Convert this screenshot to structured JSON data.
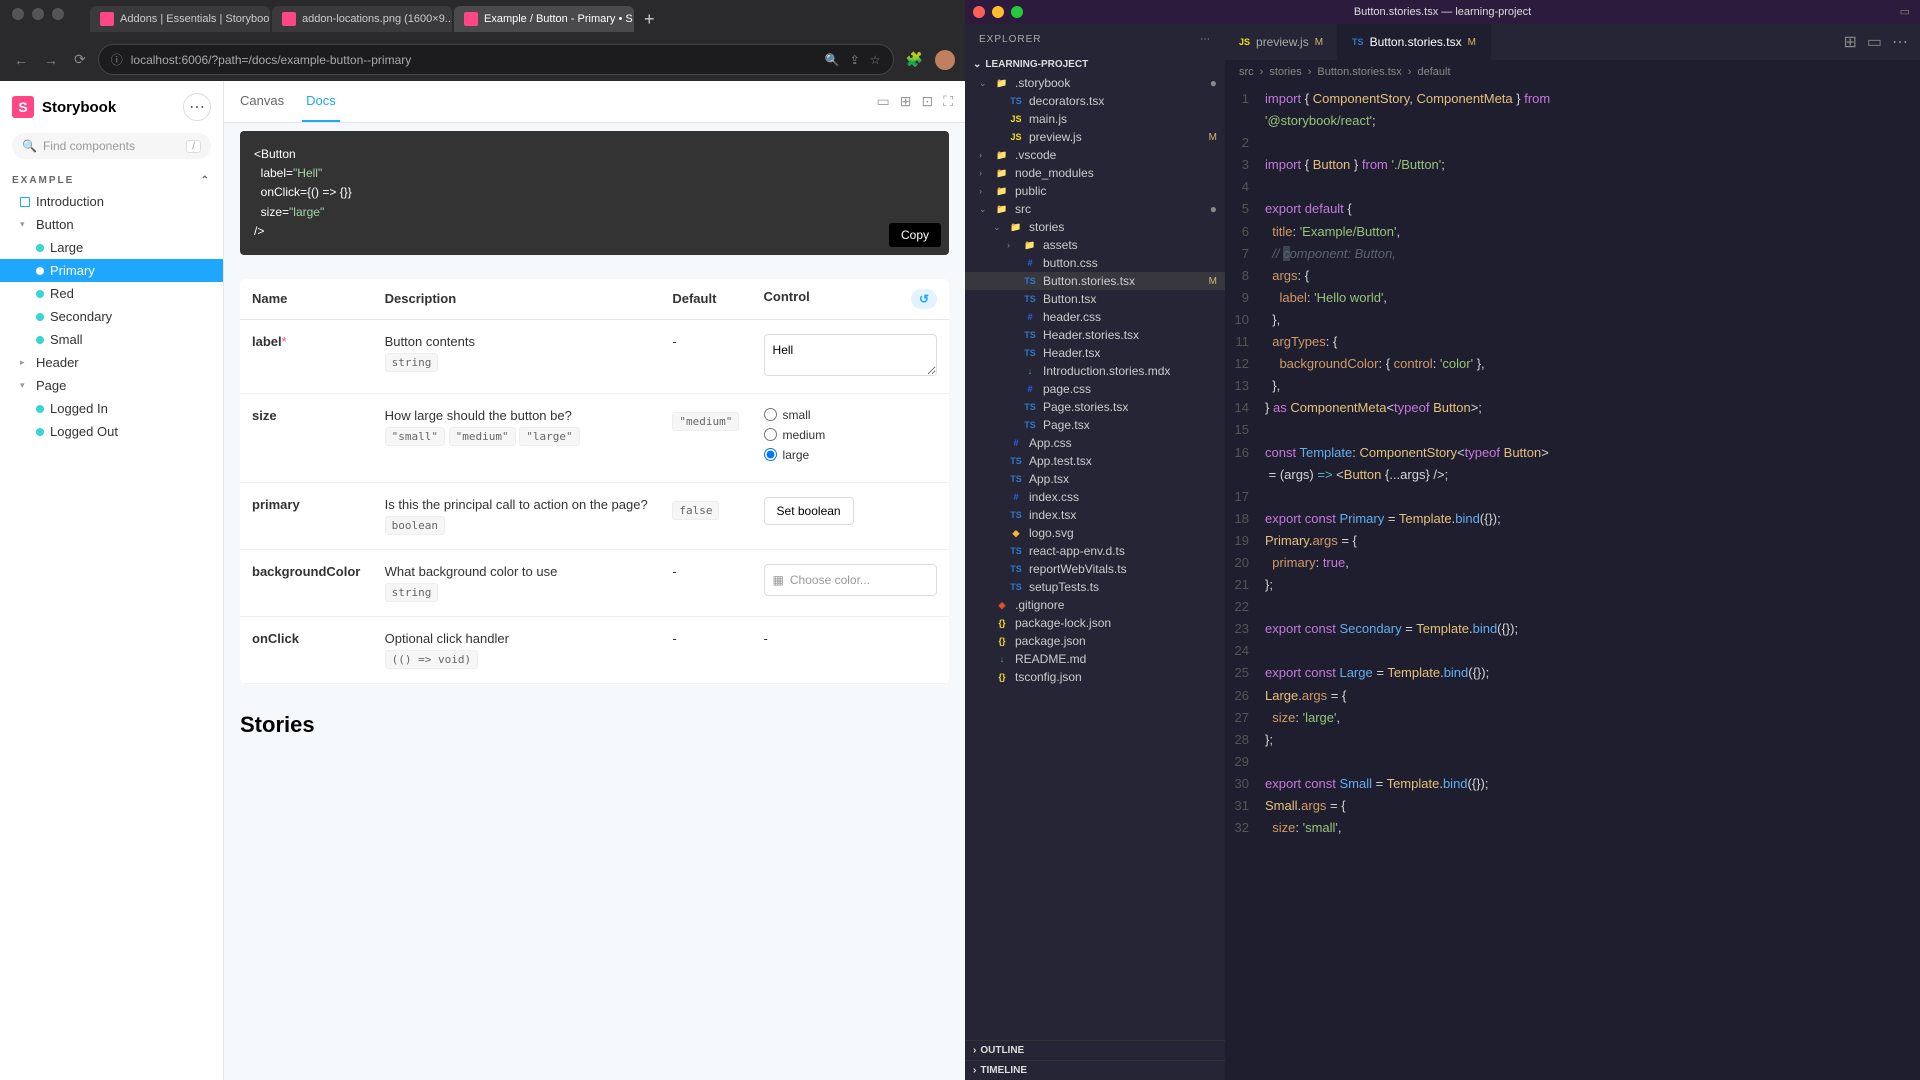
{
  "browser": {
    "tabs": [
      {
        "label": "Addons | Essentials | Storybook",
        "active": false
      },
      {
        "label": "addon-locations.png (1600×9...",
        "active": false
      },
      {
        "label": "Example / Button - Primary • S",
        "active": true
      }
    ],
    "url": "localhost:6006/?path=/docs/example-button--primary"
  },
  "storybook": {
    "brand": "Storybook",
    "search_placeholder": "Find components",
    "section": "EXAMPLE",
    "tree": {
      "intro": "Introduction",
      "button": "Button",
      "button_children": [
        "Large",
        "Primary",
        "Red",
        "Secondary",
        "Small"
      ],
      "active_child": "Primary",
      "header": "Header",
      "page": "Page",
      "page_children": [
        "Logged In",
        "Logged Out"
      ]
    },
    "tools": [
      "Canvas",
      "Docs"
    ],
    "active_tool": "Docs",
    "code_sample": "<Button\n  label=\"Hell\"\n  onClick={() => {}}\n  size=\"large\"\n/>",
    "copy": "Copy",
    "table_headers": [
      "Name",
      "Description",
      "Default",
      "Control"
    ],
    "args": [
      {
        "name": "label",
        "required": true,
        "desc": "Button contents",
        "type": "string",
        "default": "-",
        "control": "text",
        "value": "Hell"
      },
      {
        "name": "size",
        "required": false,
        "desc": "How large should the button be?",
        "types": [
          "\"small\"",
          "\"medium\"",
          "\"large\""
        ],
        "default": "\"medium\"",
        "control": "radio",
        "options": [
          "small",
          "medium",
          "large"
        ],
        "value": "large"
      },
      {
        "name": "primary",
        "required": false,
        "desc": "Is this the principal call to action on the page?",
        "type": "boolean",
        "default": "false",
        "control": "setbool",
        "btn": "Set boolean"
      },
      {
        "name": "backgroundColor",
        "required": false,
        "desc": "What background color to use",
        "type": "string",
        "default": "-",
        "control": "color",
        "placeholder": "Choose color..."
      },
      {
        "name": "onClick",
        "required": false,
        "desc": "Optional click handler",
        "type": "(() => void)",
        "default": "-",
        "control": "none",
        "value": "-"
      }
    ],
    "stories_heading": "Stories"
  },
  "vscode": {
    "title": "Button.stories.tsx — learning-project",
    "explorer_label": "EXPLORER",
    "project": "LEARNING-PROJECT",
    "outline": "OUTLINE",
    "timeline": "TIMELINE",
    "tree": [
      {
        "name": ".storybook",
        "type": "folder",
        "depth": 0,
        "open": true,
        "dot": true
      },
      {
        "name": "decorators.tsx",
        "type": "ts",
        "depth": 1
      },
      {
        "name": "main.js",
        "type": "js",
        "depth": 1
      },
      {
        "name": "preview.js",
        "type": "js",
        "depth": 1,
        "mod": "M"
      },
      {
        "name": ".vscode",
        "type": "folder",
        "depth": 0
      },
      {
        "name": "node_modules",
        "type": "folder",
        "depth": 0
      },
      {
        "name": "public",
        "type": "folder",
        "depth": 0
      },
      {
        "name": "src",
        "type": "folder",
        "depth": 0,
        "open": true,
        "dot": true
      },
      {
        "name": "stories",
        "type": "folder",
        "depth": 1,
        "open": true
      },
      {
        "name": "assets",
        "type": "folder",
        "depth": 2
      },
      {
        "name": "button.css",
        "type": "css",
        "depth": 2
      },
      {
        "name": "Button.stories.tsx",
        "type": "ts",
        "depth": 2,
        "mod": "M",
        "active": true
      },
      {
        "name": "Button.tsx",
        "type": "ts",
        "depth": 2
      },
      {
        "name": "header.css",
        "type": "css",
        "depth": 2
      },
      {
        "name": "Header.stories.tsx",
        "type": "ts",
        "depth": 2
      },
      {
        "name": "Header.tsx",
        "type": "ts",
        "depth": 2
      },
      {
        "name": "Introduction.stories.mdx",
        "type": "md",
        "depth": 2
      },
      {
        "name": "page.css",
        "type": "css",
        "depth": 2
      },
      {
        "name": "Page.stories.tsx",
        "type": "ts",
        "depth": 2
      },
      {
        "name": "Page.tsx",
        "type": "ts",
        "depth": 2
      },
      {
        "name": "App.css",
        "type": "css",
        "depth": 1
      },
      {
        "name": "App.test.tsx",
        "type": "ts",
        "depth": 1
      },
      {
        "name": "App.tsx",
        "type": "ts",
        "depth": 1
      },
      {
        "name": "index.css",
        "type": "css",
        "depth": 1
      },
      {
        "name": "index.tsx",
        "type": "ts",
        "depth": 1
      },
      {
        "name": "logo.svg",
        "type": "svg",
        "depth": 1
      },
      {
        "name": "react-app-env.d.ts",
        "type": "ts",
        "depth": 1
      },
      {
        "name": "reportWebVitals.ts",
        "type": "ts",
        "depth": 1
      },
      {
        "name": "setupTests.ts",
        "type": "ts",
        "depth": 1
      },
      {
        "name": ".gitignore",
        "type": "git",
        "depth": 0
      },
      {
        "name": "package-lock.json",
        "type": "json",
        "depth": 0
      },
      {
        "name": "package.json",
        "type": "json",
        "depth": 0
      },
      {
        "name": "README.md",
        "type": "md",
        "depth": 0
      },
      {
        "name": "tsconfig.json",
        "type": "json",
        "depth": 0
      }
    ],
    "tabs": [
      {
        "name": "preview.js",
        "icon": "JS",
        "mod": "M"
      },
      {
        "name": "Button.stories.tsx",
        "icon": "TS",
        "mod": "M",
        "active": true
      }
    ],
    "breadcrumb": [
      "src",
      "stories",
      "Button.stories.tsx",
      "default"
    ],
    "code_lines": [
      {
        "n": 1,
        "html": "<span class='kw'>import</span> { <span class='ty'>ComponentStory</span>, <span class='ty'>ComponentMeta</span> } <span class='kw'>from</span>"
      },
      {
        "n": "",
        "html": "<span class='st'>'@storybook/react'</span>;"
      },
      {
        "n": 2,
        "html": ""
      },
      {
        "n": 3,
        "html": "<span class='kw'>import</span> { <span class='ty'>Button</span> } <span class='kw'>from</span> <span class='st'>'./Button'</span>;"
      },
      {
        "n": 4,
        "html": ""
      },
      {
        "n": 5,
        "html": "<span class='kw'>export</span> <span class='kw'>default</span> {"
      },
      {
        "n": 6,
        "html": "  <span class='pr'>title</span>: <span class='st'>'Example/Button'</span>,"
      },
      {
        "n": 7,
        "html": "  <span class='cm'>// <span class='sel'>c</span>omponent: Button,</span>"
      },
      {
        "n": 8,
        "html": "  <span class='pr'>args</span>: {"
      },
      {
        "n": 9,
        "html": "    <span class='pr'>label</span>: <span class='st'>'Hello world'</span>,"
      },
      {
        "n": 10,
        "html": "  },"
      },
      {
        "n": 11,
        "html": "  <span class='pr'>argTypes</span>: {"
      },
      {
        "n": 12,
        "html": "    <span class='pr'>backgroundColor</span>: { <span class='pr'>control</span>: <span class='st'>'color'</span> },"
      },
      {
        "n": 13,
        "html": "  },"
      },
      {
        "n": 14,
        "html": "} <span class='kw'>as</span> <span class='ty'>ComponentMeta</span>&lt;<span class='kw'>typeof</span> <span class='ty'>Button</span>&gt;;"
      },
      {
        "n": 15,
        "html": ""
      },
      {
        "n": 16,
        "html": "<span class='kw'>const</span> <span class='fn'>Template</span>: <span class='ty'>ComponentStory</span>&lt;<span class='kw'>typeof</span> <span class='ty'>Button</span>&gt;"
      },
      {
        "n": "",
        "html": " = (args) <span class='op'>=&gt;</span> &lt;<span class='ty'>Button</span> {...args} /&gt;;"
      },
      {
        "n": 17,
        "html": ""
      },
      {
        "n": 18,
        "html": "<span class='kw'>export</span> <span class='kw'>const</span> <span class='fn'>Primary</span> = <span class='ty'>Template</span>.<span class='fn'>bind</span>({});"
      },
      {
        "n": 19,
        "html": "<span class='ty'>Primary</span>.<span class='pr'>args</span> = {"
      },
      {
        "n": 20,
        "html": "  <span class='pr'>primary</span>: <span class='kw'>true</span>,"
      },
      {
        "n": 21,
        "html": "};"
      },
      {
        "n": 22,
        "html": ""
      },
      {
        "n": 23,
        "html": "<span class='kw'>export</span> <span class='kw'>const</span> <span class='fn'>Secondary</span> = <span class='ty'>Template</span>.<span class='fn'>bind</span>({});"
      },
      {
        "n": 24,
        "html": ""
      },
      {
        "n": 25,
        "html": "<span class='kw'>export</span> <span class='kw'>const</span> <span class='fn'>Large</span> = <span class='ty'>Template</span>.<span class='fn'>bind</span>({});"
      },
      {
        "n": 26,
        "html": "<span class='ty'>Large</span>.<span class='pr'>args</span> = {"
      },
      {
        "n": 27,
        "html": "  <span class='pr'>size</span>: <span class='st'>'large'</span>,"
      },
      {
        "n": 28,
        "html": "};"
      },
      {
        "n": 29,
        "html": ""
      },
      {
        "n": 30,
        "html": "<span class='kw'>export</span> <span class='kw'>const</span> <span class='fn'>Small</span> = <span class='ty'>Template</span>.<span class='fn'>bind</span>({});"
      },
      {
        "n": 31,
        "html": "<span class='ty'>Small</span>.<span class='pr'>args</span> = {"
      },
      {
        "n": 32,
        "html": "  <span class='pr'>size</span>: <span class='st'>'small'</span>,"
      }
    ]
  }
}
